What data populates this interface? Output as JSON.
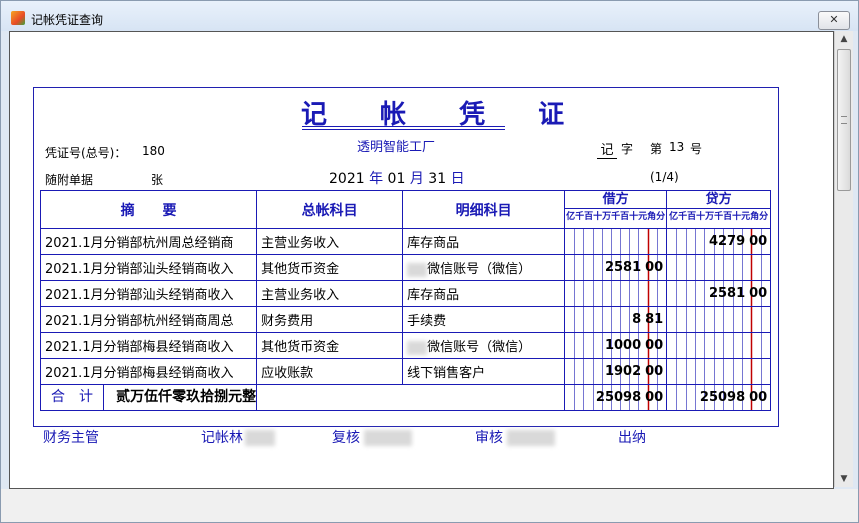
{
  "window": {
    "title": "记帐凭证查询",
    "close_label": "✕"
  },
  "voucher": {
    "title": "记 帐 凭 证",
    "company": "透明智能工厂",
    "voucher_no_label": "凭证号(总号)：",
    "voucher_no_value": "180",
    "type_char": "记",
    "type_label": "字",
    "number_prefix": "第",
    "number_value": "13",
    "number_suffix": "号",
    "attachments_label": "随附单据",
    "attachments_unit": "张",
    "date": {
      "year": "2021",
      "year_label": "年",
      "month": "01",
      "month_label": "月",
      "day": "31",
      "day_label": "日"
    },
    "page": "(1/4)"
  },
  "table": {
    "headers": {
      "summary": "摘　　要",
      "account": "总帐科目",
      "detail": "明细科目",
      "debit": "借方",
      "credit": "贷方"
    },
    "digit_header": "亿千百十万千百十元角分",
    "rows": [
      {
        "summary": "2021.1月分销部杭州周总经销商",
        "account": "主营业务收入",
        "detail": "库存商品",
        "debit_int": "",
        "debit_frac": "",
        "credit_int": "4279",
        "credit_frac": "00"
      },
      {
        "summary": "2021.1月分销部汕头经销商收入",
        "account": "其他货币资金",
        "detail": "微信账号（微信）",
        "debit_int": "2581",
        "debit_frac": "00",
        "credit_int": "",
        "credit_frac": ""
      },
      {
        "summary": "2021.1月分销部汕头经销商收入",
        "account": "主营业务收入",
        "detail": "库存商品",
        "debit_int": "",
        "debit_frac": "",
        "credit_int": "2581",
        "credit_frac": "00"
      },
      {
        "summary": "2021.1月分销部杭州经销商周总",
        "account": "财务费用",
        "detail": "手续费",
        "debit_int": "8",
        "debit_frac": "81",
        "credit_int": "",
        "credit_frac": ""
      },
      {
        "summary": "2021.1月分销部梅县经销商收入",
        "account": "其他货币资金",
        "detail": "微信账号（微信）",
        "debit_int": "1000",
        "debit_frac": "00",
        "credit_int": "",
        "credit_frac": ""
      },
      {
        "summary": "2021.1月分销部梅县经销商收入",
        "account": "应收账款",
        "detail": "线下销售客户",
        "debit_int": "1902",
        "debit_frac": "00",
        "credit_int": "",
        "credit_frac": ""
      }
    ],
    "total_label": "合　计",
    "total_words": "贰万伍仟零玖拾捌元整",
    "total_debit_int": "25098",
    "total_debit_frac": "00",
    "total_credit_int": "25098",
    "total_credit_frac": "00"
  },
  "signatures": {
    "finance_manager": "财务主管",
    "bookkeeper": "记帐林",
    "reviewer": "复核",
    "auditor": "审核",
    "cashier": "出纳"
  },
  "colors": {
    "accent": "#1a1ab5",
    "red_divider": "#c00000"
  }
}
